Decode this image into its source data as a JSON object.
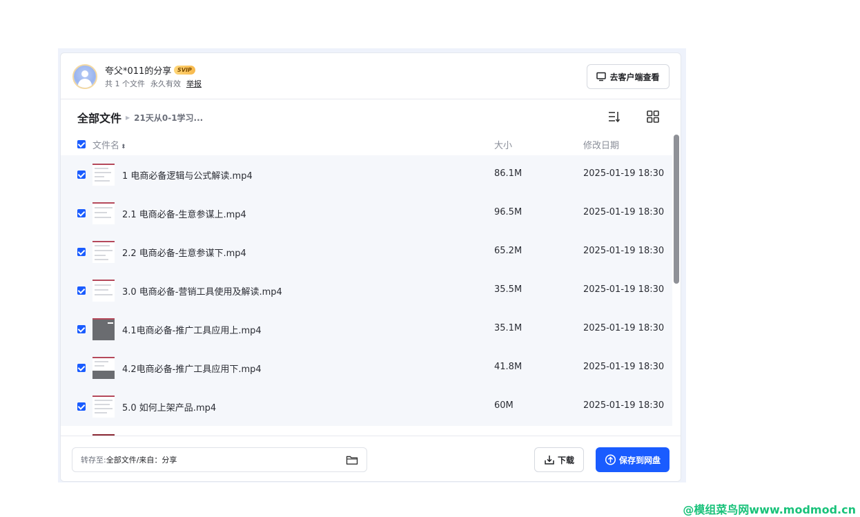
{
  "header": {
    "share_title": "夸父*011的分享",
    "vip_badge": "SVIP",
    "file_count": "共 1 个文件",
    "validity": "永久有效",
    "report_link": "举报",
    "client_button": "去客户端查看"
  },
  "breadcrumb": {
    "root": "全部文件",
    "current": "21天从0-1学习..."
  },
  "table": {
    "col_name": "文件名",
    "col_size": "大小",
    "col_date": "修改日期",
    "rows": [
      {
        "name": "1 电商必备逻辑与公式解读.mp4",
        "size": "86.1M",
        "date": "2025-01-19 18:30"
      },
      {
        "name": "2.1 电商必备-生意参谋上.mp4",
        "size": "96.5M",
        "date": "2025-01-19 18:30"
      },
      {
        "name": "2.2 电商必备-生意参谋下.mp4",
        "size": "65.2M",
        "date": "2025-01-19 18:30"
      },
      {
        "name": "3.0 电商必备-营销工具使用及解读.mp4",
        "size": "35.5M",
        "date": "2025-01-19 18:30"
      },
      {
        "name": "4.1电商必备-推广工具应用上.mp4",
        "size": "35.1M",
        "date": "2025-01-19 18:30"
      },
      {
        "name": "4.2电商必备-推广工具应用下.mp4",
        "size": "41.8M",
        "date": "2025-01-19 18:30"
      },
      {
        "name": "5.0 如何上架产品.mp4",
        "size": "60M",
        "date": "2025-01-19 18:30"
      }
    ]
  },
  "footer": {
    "save_path_label": "转存至:",
    "save_path_value": "全部文件/来自：分享",
    "download_button": "下载",
    "save_button": "保存到网盘"
  },
  "watermark": "@模组菜鸟网www.modmod.cn",
  "colors": {
    "accent": "#1a5cff",
    "row_bg": "#f5f7fb",
    "watermark": "#19c27a"
  }
}
